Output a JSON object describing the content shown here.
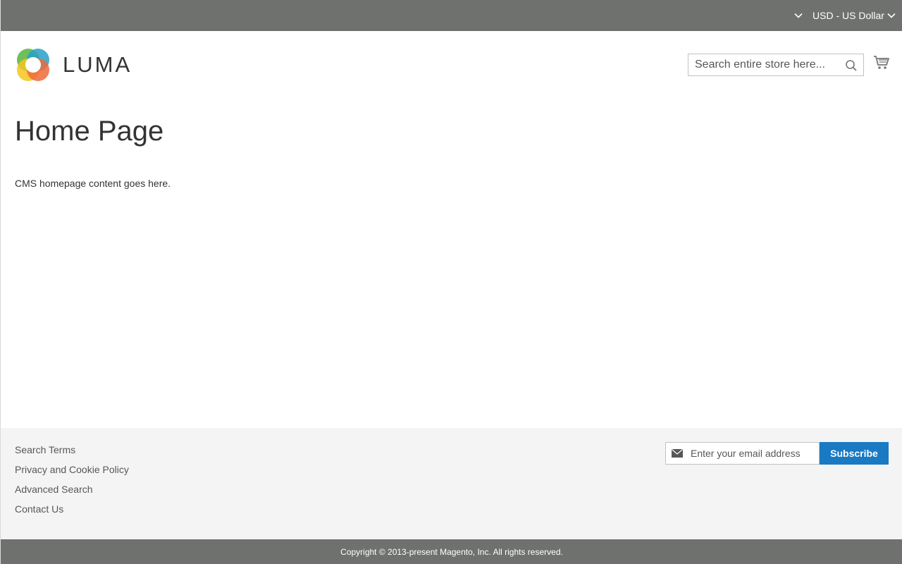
{
  "topbar": {
    "currency_label": "USD - US Dollar",
    "background": "#6e716e"
  },
  "header": {
    "logo_text": "LUMA",
    "search": {
      "placeholder": "Search entire store here...",
      "value": ""
    },
    "icons": [
      "chevron-down-icon",
      "search-icon",
      "cart-icon"
    ]
  },
  "main": {
    "title": "Home Page",
    "content": "CMS homepage content goes here."
  },
  "footer": {
    "links": [
      {
        "label": "Search Terms"
      },
      {
        "label": "Privacy and Cookie Policy"
      },
      {
        "label": "Advanced Search"
      },
      {
        "label": "Contact Us"
      }
    ],
    "newsletter": {
      "placeholder": "Enter your email address",
      "button_label": "Subscribe",
      "button_color": "#1979c3"
    },
    "copyright": "Copyright © 2013-present Magento, Inc. All rights reserved."
  }
}
